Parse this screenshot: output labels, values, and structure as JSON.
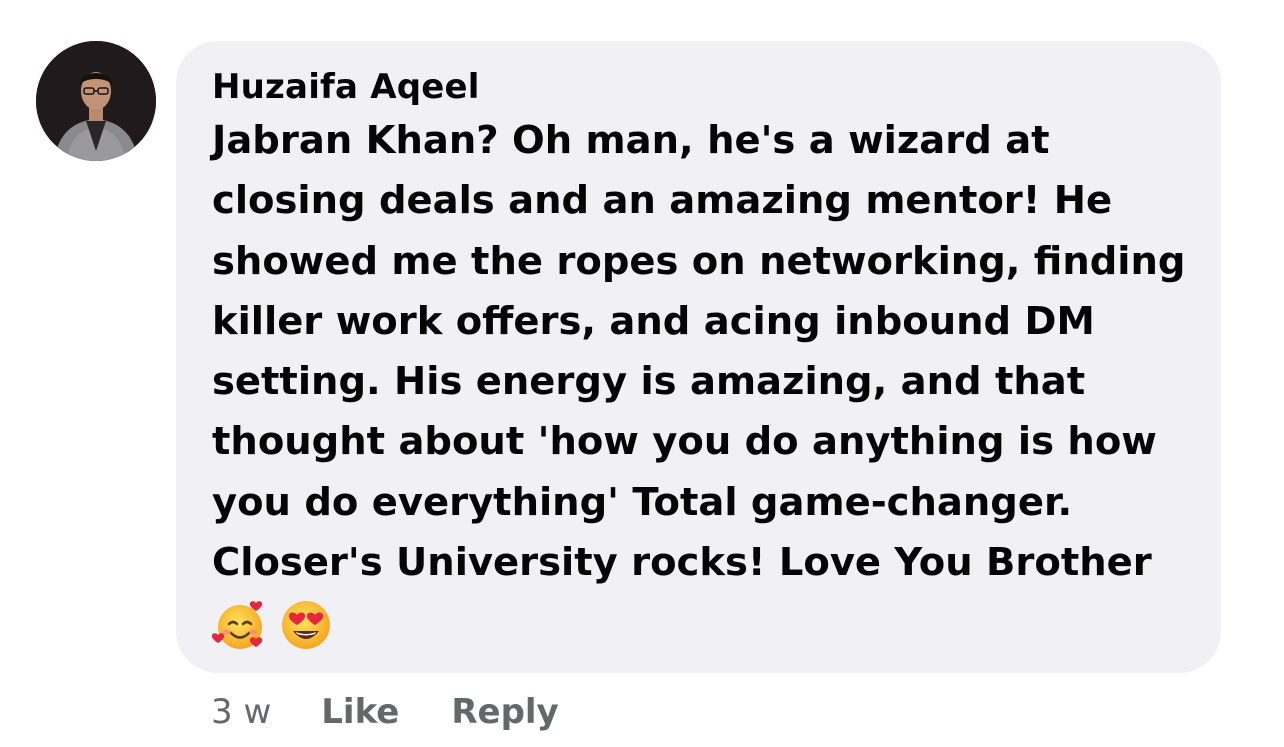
{
  "comment": {
    "author": "Huzaifa Aqeel",
    "lines": [
      "Jabran Khan? Oh man, he's a wizard at",
      "closing deals and an amazing mentor! He",
      "showed me the ropes on networking, finding",
      "killer work offers, and acing inbound DM",
      "setting. His energy is amazing, and that",
      "thought about 'how you do anything is how",
      "you do everything' Total game-changer.",
      "Closer's University rocks! Love You Brother"
    ],
    "emojis": [
      "smiling-face-with-hearts-emoji",
      "heart-eyes-emoji"
    ]
  },
  "actions": {
    "time": "3 w",
    "like_label": "Like",
    "reply_label": "Reply"
  },
  "colors": {
    "bubble_bg": "#f0f0f5",
    "text": "#050505",
    "meta": "#65676b"
  }
}
